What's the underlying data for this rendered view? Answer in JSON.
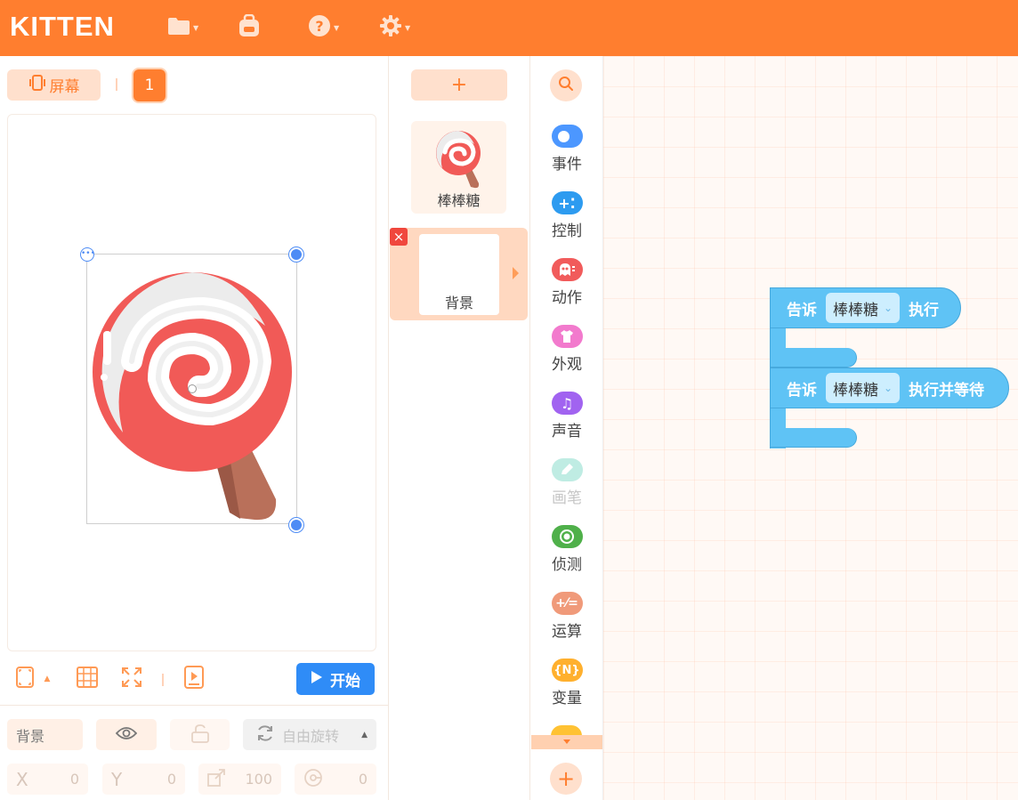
{
  "app": {
    "logo": "KITTEN"
  },
  "topbar": {
    "icons": [
      "folder-icon",
      "backpack-icon",
      "help-icon",
      "settings-icon"
    ]
  },
  "stage": {
    "screen_label": "屏幕",
    "screen_number": "1",
    "start_label": "开始",
    "sprite_name": "棒棒糖"
  },
  "properties": {
    "name_value": "背景",
    "rotation_mode": "自由旋转",
    "x_label": "X",
    "x_value": "0",
    "y_label": "Y",
    "y_value": "0",
    "scale_value": "100",
    "direction_value": "0"
  },
  "sprites": {
    "add_label": "+",
    "items": [
      {
        "name": "棒棒糖"
      },
      {
        "name": "背景"
      }
    ]
  },
  "categories": [
    {
      "label": "事件",
      "color": "#4c97ff"
    },
    {
      "label": "控制",
      "color": "#2d9bf0"
    },
    {
      "label": "动作",
      "color": "#f15b5b"
    },
    {
      "label": "外观",
      "color": "#f27acd"
    },
    {
      "label": "声音",
      "color": "#a163f0"
    },
    {
      "label": "画笔",
      "color": "#bfece3"
    },
    {
      "label": "侦测",
      "color": "#4fb04a"
    },
    {
      "label": "运算",
      "color": "#f09a7a"
    },
    {
      "label": "变量",
      "color": "#ffb02e"
    }
  ],
  "blocks": [
    {
      "prefix": "告诉",
      "target": "棒棒糖",
      "suffix": "执行"
    },
    {
      "prefix": "告诉",
      "target": "棒棒糖",
      "suffix": "执行并等待"
    }
  ],
  "colors": {
    "accent": "#ff7e2f",
    "block": "#5fc3f5",
    "start": "#2f8cf7"
  }
}
